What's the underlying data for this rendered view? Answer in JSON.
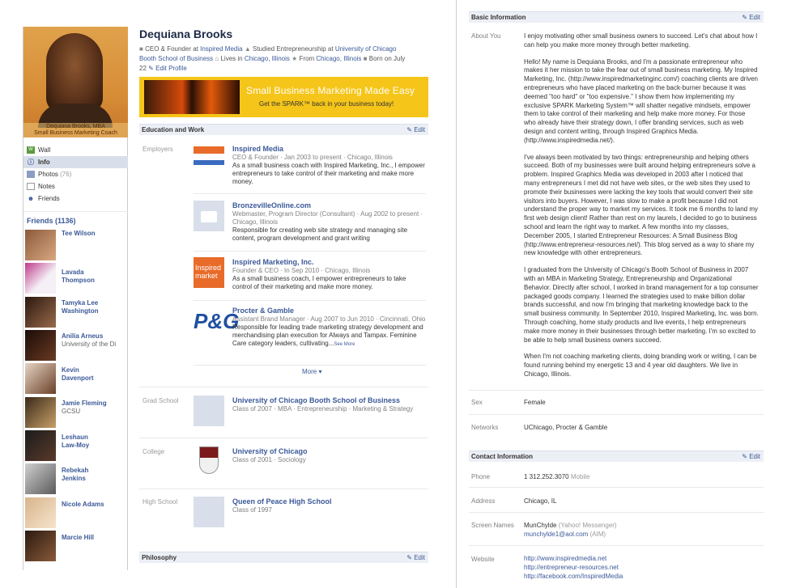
{
  "profile": {
    "name": "Dequiana Brooks",
    "photo_caption_1": "Dequiana Brooks, MBA",
    "photo_caption_2": "Small Business Marketing Coach",
    "meta_line1_pre": "CEO & Founder at ",
    "meta_line1_link": "Inspired Media",
    "meta_line1_mid": "Studied Entrepreneurship at ",
    "meta_line1_link2": "University of Chicago",
    "meta_line2_link": "Booth School of Business",
    "meta_line2_lives": "Lives in ",
    "meta_line2_city": "Chicago, Illinois",
    "meta_line2_from": "From ",
    "meta_line2_from_city": "Chicago, Illinois",
    "meta_line2_born": "Born on July",
    "meta_line3_born": "22",
    "edit_profile": "Edit Profile"
  },
  "nav": {
    "wall": "Wall",
    "info": "Info",
    "photos": "Photos",
    "photos_count": "(76)",
    "notes": "Notes",
    "friends": "Friends"
  },
  "friends": {
    "header": "Friends (1136)",
    "list": [
      {
        "name": "Tee Wilson",
        "sub": ""
      },
      {
        "name": "Lavada Thompson",
        "sub": ""
      },
      {
        "name": "Tamyka Lee Washington",
        "sub": ""
      },
      {
        "name": "Anilia Arneus",
        "sub": "University of the Di"
      },
      {
        "name": "Kevin Davenport",
        "sub": ""
      },
      {
        "name": "Jamie Fleming",
        "sub": "GCSU"
      },
      {
        "name": "Leshaun Law-Moy",
        "sub": ""
      },
      {
        "name": "Rebekah Jenkins",
        "sub": ""
      },
      {
        "name": "Nicole Adams",
        "sub": ""
      },
      {
        "name": "Marcie Hill",
        "sub": ""
      }
    ]
  },
  "banner": {
    "title": "Small Business Marketing Made Easy",
    "tagline": "Get the SPARK™ back in your business today!"
  },
  "sections": {
    "education_work": "Education and Work",
    "philosophy": "Philosophy",
    "edit": "Edit",
    "more": "More ▾",
    "see_more": "See More"
  },
  "labels": {
    "employers": "Employers",
    "grad_school": "Grad School",
    "college": "College",
    "high_school": "High School"
  },
  "jobs": [
    {
      "title": "Inspired Media",
      "sub": "CEO & Founder · Jan 2003 to present · Chicago, Illinois",
      "desc": "As a small business coach with Inspired Marketing, Inc., I empower entrepreneurs to take control of their marketing and make more money."
    },
    {
      "title": "BronzevilleOnline.com",
      "sub": "Webmaster, Program Director (Consultant) · Aug 2002 to present · Chicago, Illinois",
      "desc": "Responsible for creating web site strategy and managing site content, program development and grant writing"
    },
    {
      "title": "Inspired Marketing, Inc.",
      "sub": "Founder & CEO · In Sep 2010 · Chicago, Illinois",
      "desc": "As a small business coach, I empower entrepreneurs to take control of their marketing and make more money."
    },
    {
      "title": "Procter & Gamble",
      "sub": "Assistant Brand Manager · Aug 2007 to Jun 2010 · Cincinnati, Ohio",
      "desc": "Responsible for leading trade marketing strategy development and merchandising plan execution for Always and Tampax. Feminine Care category leaders, cultivating..."
    }
  ],
  "schools": {
    "grad": {
      "title": "University of Chicago Booth School of Business",
      "sub": "Class of 2007 · MBA · Entrepreneurship · Marketing & Strategy"
    },
    "college": {
      "title": "University of Chicago",
      "sub": "Class of 2001 · Sociology"
    },
    "high": {
      "title": "Queen of Peace High School",
      "sub": "Class of 1997"
    }
  },
  "basic": {
    "header": "Basic Information",
    "about_label": "About You",
    "about": [
      "I enjoy motivating other small business owners to succeed. Let's chat about how I can help you make more money through better marketing.",
      "Hello! My name is Dequiana Brooks, and I'm a passionate entrepreneur who makes it her mission to take the fear out of small business marketing. My Inspired Marketing, Inc. (http://www.inspiredmarketinginc.com/) coaching clients are driven entrepreneurs who have placed marketing on the back-burner because it was deemed \"too hard\" or \"too expensive.\" I show them how implementing my exclusive SPARK Marketing System™ will shatter negative mindsets, empower them to take control of their marketing and help make more money. For those who already have their strategy down, I offer branding services, such as web design and content writing, through Inspired Graphics Media. (http://www.inspiredmedia.net/).",
      "I've always been motivated by two things: entrepreneurship and helping others succeed. Both of my businesses were built around helping entrepreneurs solve a problem. Inspired Graphics Media was developed in 2003 after I noticed that many entrepreneurs I met did not have web sites, or the web sites they used to promote their businesses were lacking the key tools that would convert their site visitors into buyers. However, I was slow to make a profit because I did not understand the proper way to market my services. It took me 6 months to land my first web design client! Rather than rest on my laurels, I decided to go to business school and learn the right way to market. A few months into my classes, December 2005, I started Entrepreneur Resources: A Small Business Blog (http://www.entrepreneur-resources.net/). This blog served as a way to share my new knowledge with other entrepreneurs.",
      "I graduated from the University of Chicago's Booth School of Business in 2007 with an MBA in Marketing Strategy, Entrepreneurship and Organizational Behavior. Directly after school, I worked in brand management for a top consumer packaged goods company. I learned the strategies used to make billion dollar brands successful, and now I'm bringing that marketing knowledge back to the small business community. In September 2010, Inspired Marketing, Inc. was born. Through coaching, home study products and live events, I help entrepreneurs make more money in their businesses through better marketing. I'm so excited to be able to help small business owners succeed.",
      "When I'm not coaching marketing clients, doing branding work or writing, I can be found running behind my energetic 13 and 4 year old daughters. We live in Chicago, Illinois."
    ],
    "sex_label": "Sex",
    "sex": "Female",
    "networks_label": "Networks",
    "networks": "UChicago, Procter & Gamble"
  },
  "contact": {
    "header": "Contact Information",
    "phone_label": "Phone",
    "phone": "1 312.252.3070",
    "phone_type": "Mobile",
    "address_label": "Address",
    "address": "Chicago, IL",
    "screen_label": "Screen Names",
    "sn1": "MunChylde",
    "sn1_type": "(Yahoo! Messenger)",
    "sn2": "munchylde1@aol.com",
    "sn2_type": "(AIM)",
    "website_label": "Website",
    "web1": "http://www.inspiredmedia.net",
    "web2": "http://entrepreneur-resources.net",
    "web3": "http://facebook.com/InspiredMedia"
  }
}
